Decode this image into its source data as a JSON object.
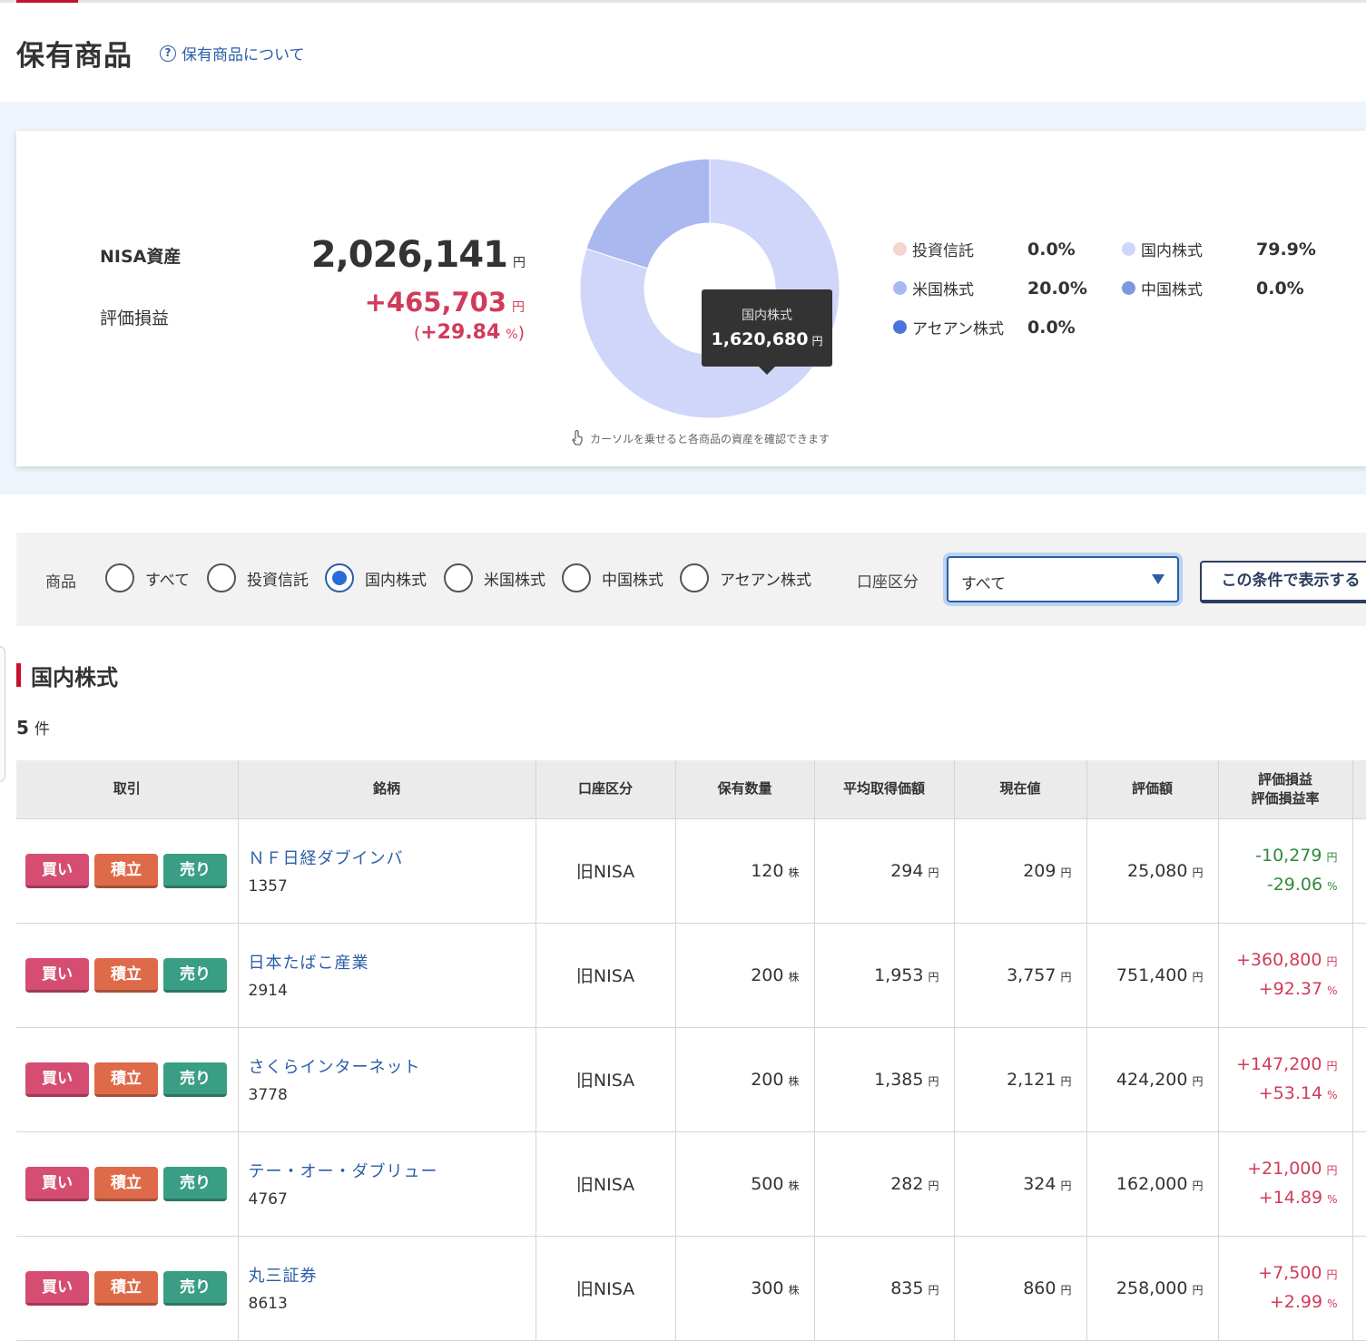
{
  "header": {
    "title": "保有商品",
    "about_link": "保有商品について",
    "help_icon": "question-circle-icon"
  },
  "summary": {
    "nisa_label": "NISA資産",
    "nisa_value": "2,026,141",
    "pl_label": "評価損益",
    "pl_value": "+465,703",
    "pl_rate": "+29.84",
    "unit_yen": "円",
    "unit_pct": "%",
    "paren_open": "(",
    "paren_close": ")",
    "tooltip_name": "国内株式",
    "tooltip_value": "1,620,680",
    "hint": "カーソルを乗せると各商品の資産を確認できます"
  },
  "chart_data": {
    "type": "pie",
    "categories": [
      "投資信託",
      "国内株式",
      "米国株式",
      "中国株式",
      "アセアン株式"
    ],
    "values": [
      0.0,
      79.9,
      20.0,
      0.0,
      0.0
    ],
    "pct_labels": [
      "0.0%",
      "79.9%",
      "20.0%",
      "0.0%",
      "0.0%"
    ],
    "colors": [
      "#f5d6cf",
      "#cfd6fa",
      "#aab8f0",
      "#7f97e0",
      "#4e73d8"
    ],
    "legend_placement": "right"
  },
  "filter": {
    "product_label": "商品",
    "options": [
      "すべて",
      "投資信託",
      "国内株式",
      "米国株式",
      "中国株式",
      "アセアン株式"
    ],
    "selected": "国内株式",
    "account_label": "口座区分",
    "account_value": "すべて",
    "show_button": "この条件で表示する"
  },
  "section": {
    "title": "国内株式",
    "count": "5",
    "count_unit": "件"
  },
  "table": {
    "headers": {
      "trade": "取引",
      "name": "銘柄",
      "account": "口座区分",
      "qty": "保有数量",
      "avg": "平均取得価額",
      "price": "現在値",
      "eval": "評価額",
      "pl1": "評価損益",
      "pl2": "評価損益率"
    },
    "buttons": {
      "buy": "買い",
      "tsumi": "積立",
      "sell": "売り"
    },
    "unit_share": "株",
    "unit_yen": "円",
    "unit_pct": "%",
    "rows": [
      {
        "name": "ＮＦ日経ダブインバ",
        "code": "1357",
        "account": "旧NISA",
        "qty": "120",
        "avg": "294",
        "price": "209",
        "eval": "25,080",
        "pl": "-10,279",
        "rate": "-29.06",
        "sign": "neg"
      },
      {
        "name": "日本たばこ産業",
        "code": "2914",
        "account": "旧NISA",
        "qty": "200",
        "avg": "1,953",
        "price": "3,757",
        "eval": "751,400",
        "pl": "+360,800",
        "rate": "+92.37",
        "sign": "pos"
      },
      {
        "name": "さくらインターネット",
        "code": "3778",
        "account": "旧NISA",
        "qty": "200",
        "avg": "1,385",
        "price": "2,121",
        "eval": "424,200",
        "pl": "+147,200",
        "rate": "+53.14",
        "sign": "pos"
      },
      {
        "name": "テー・オー・ダブリュー",
        "code": "4767",
        "account": "旧NISA",
        "qty": "500",
        "avg": "282",
        "price": "324",
        "eval": "162,000",
        "pl": "+21,000",
        "rate": "+14.89",
        "sign": "pos"
      },
      {
        "name": "丸三証券",
        "code": "8613",
        "account": "旧NISA",
        "qty": "300",
        "avg": "835",
        "price": "860",
        "eval": "258,000",
        "pl": "+7,500",
        "rate": "+2.99",
        "sign": "pos"
      }
    ]
  }
}
